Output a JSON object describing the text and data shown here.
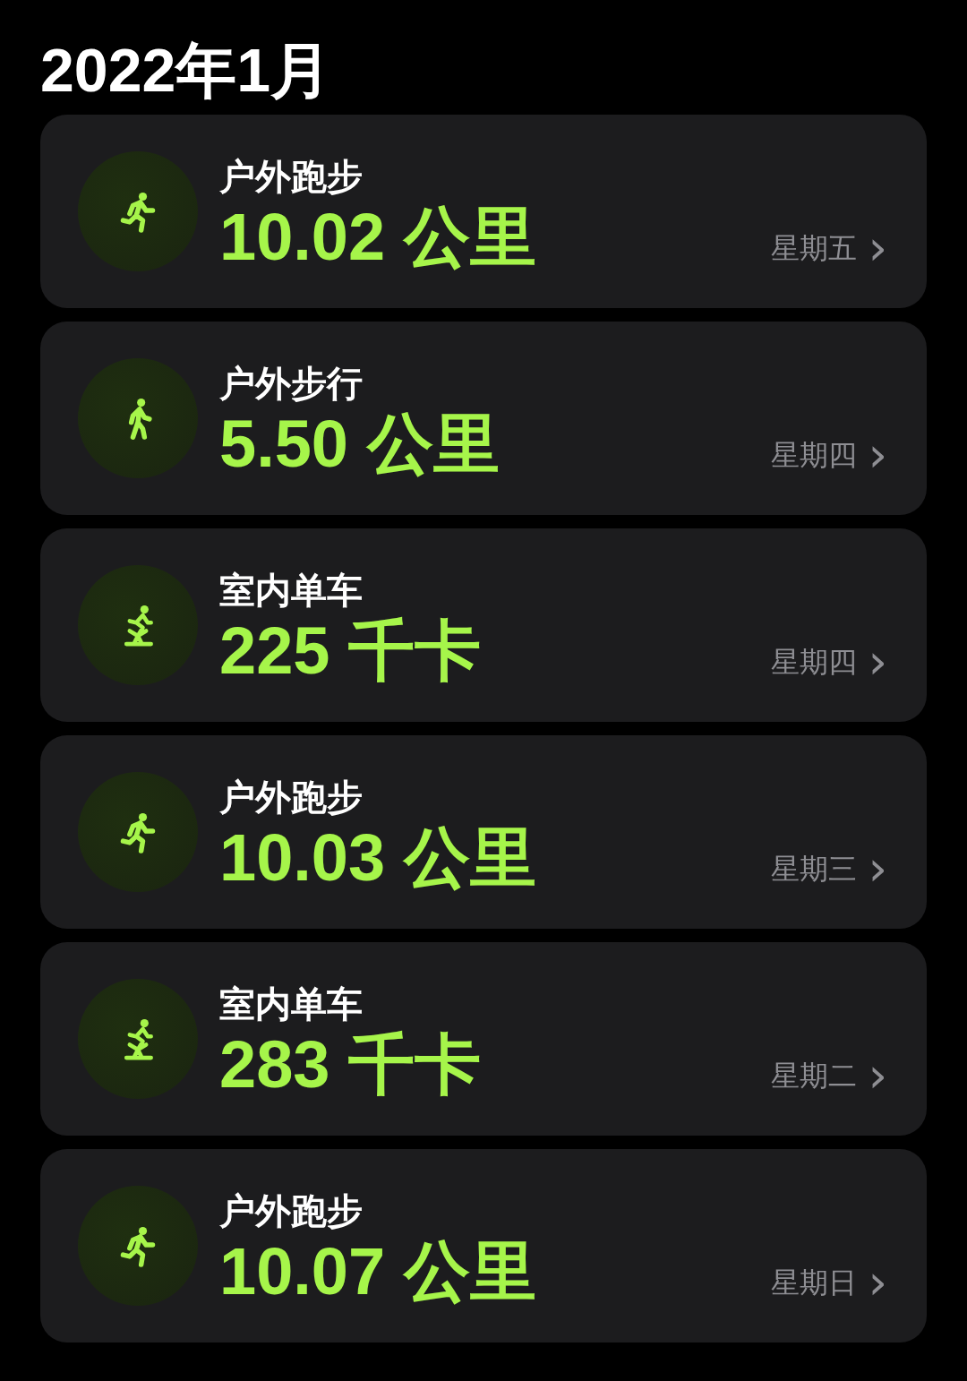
{
  "title": "2022年1月",
  "workouts": [
    {
      "kind": "run",
      "name": "户外跑步",
      "value": "10.02 公里",
      "day": "星期五",
      "chevron": "›"
    },
    {
      "kind": "walk",
      "name": "户外步行",
      "value": "5.50 公里",
      "day": "星期四",
      "chevron": "›"
    },
    {
      "kind": "bike",
      "name": "室内单车",
      "value": "225 千卡",
      "day": "星期四",
      "chevron": "›"
    },
    {
      "kind": "run",
      "name": "户外跑步",
      "value": "10.03 公里",
      "day": "星期三",
      "chevron": "›"
    },
    {
      "kind": "bike",
      "name": "室内单车",
      "value": "283 千卡",
      "day": "星期二",
      "chevron": "›"
    },
    {
      "kind": "run",
      "name": "户外跑步",
      "value": "10.07 公里",
      "day": "星期日",
      "chevron": "›"
    }
  ]
}
